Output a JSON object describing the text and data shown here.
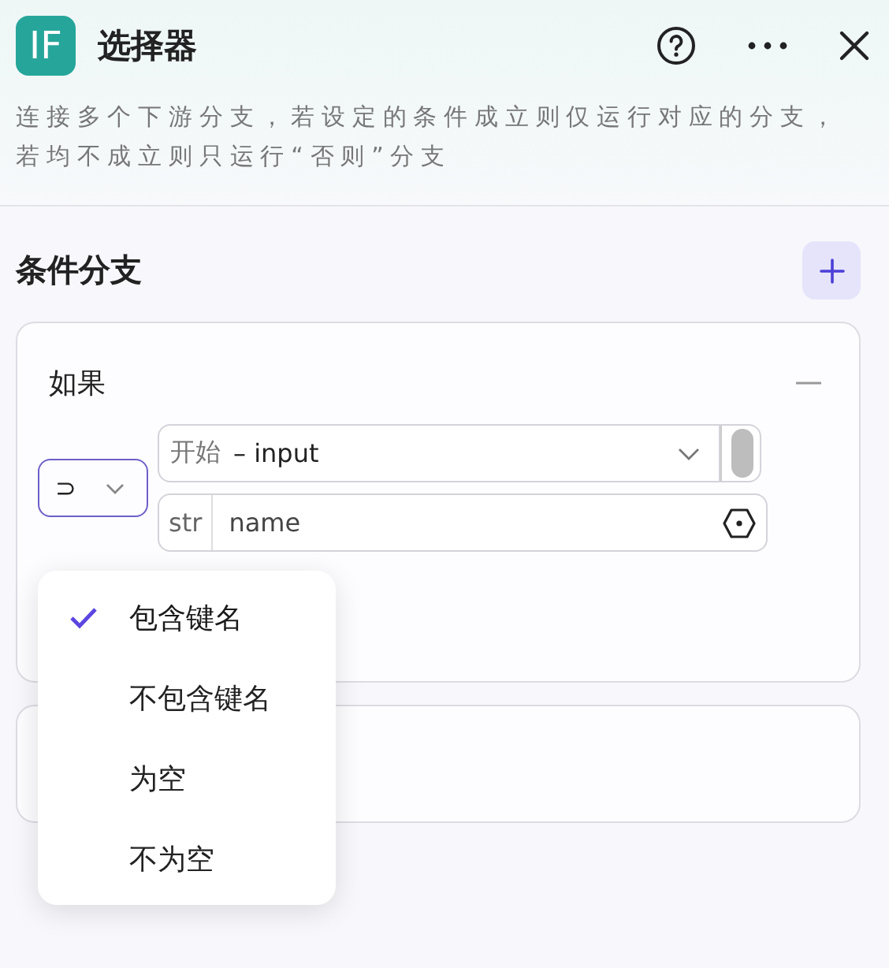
{
  "header": {
    "logo": "IF",
    "title": "选择器",
    "description": "连接多个下游分支，若设定的条件成立则仅运行对应的分支，若均不成立则只运行“否则”分支"
  },
  "section": {
    "title": "条件分支"
  },
  "branch": {
    "label": "如果",
    "operator": "⊃",
    "source_prefix": "开始",
    "source": "– input",
    "type": "str",
    "key": "name"
  },
  "dropdown": {
    "options": [
      {
        "label": "包含键名",
        "selected": true
      },
      {
        "label": "不包含键名",
        "selected": false
      },
      {
        "label": "为空",
        "selected": false
      },
      {
        "label": "不为空",
        "selected": false
      }
    ]
  }
}
